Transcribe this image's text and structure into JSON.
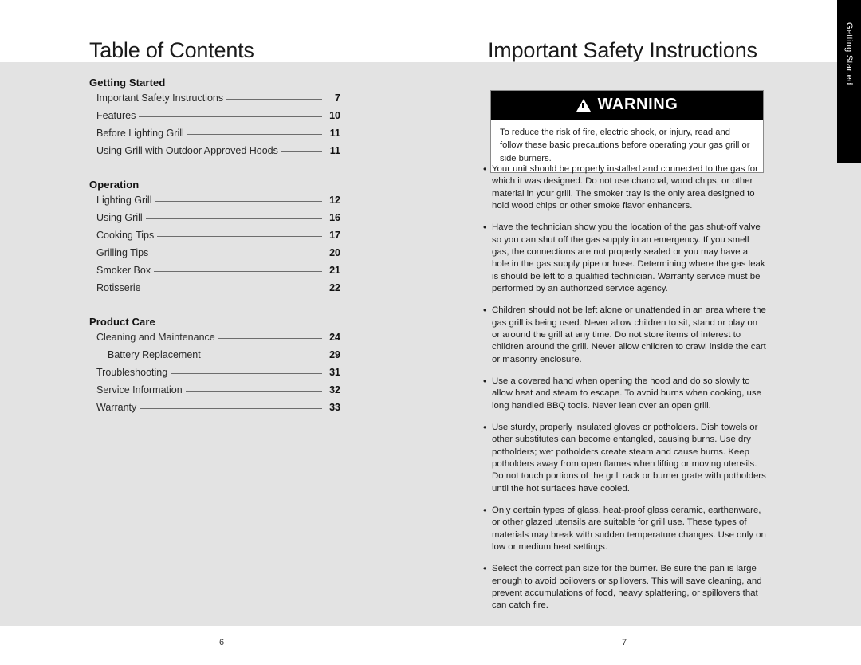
{
  "document": {
    "background_color": "#e3e3e3",
    "page_color": "#ffffff"
  },
  "thumb_tab": {
    "label": "Getting Started",
    "background_color": "#000000",
    "text_color": "#ffffff"
  },
  "left_page": {
    "title": "Table of Contents",
    "page_number": "6",
    "toc": [
      {
        "heading": "Getting Started",
        "entries": [
          {
            "label": "Important Safety Instructions",
            "page": "7",
            "indent": false
          },
          {
            "label": "Features",
            "page": "10",
            "indent": false
          },
          {
            "label": "Before Lighting Grill",
            "page": "11",
            "indent": false
          },
          {
            "label": "Using Grill with Outdoor Approved Hoods",
            "page": "11",
            "indent": false
          }
        ]
      },
      {
        "heading": "Operation",
        "entries": [
          {
            "label": "Lighting Grill",
            "page": "12",
            "indent": false
          },
          {
            "label": "Using Grill",
            "page": "16",
            "indent": false
          },
          {
            "label": "Cooking Tips",
            "page": "17",
            "indent": false
          },
          {
            "label": "Grilling Tips",
            "page": "20",
            "indent": false
          },
          {
            "label": "Smoker Box",
            "page": "21",
            "indent": false
          },
          {
            "label": "Rotisserie",
            "page": "22",
            "indent": false
          }
        ]
      },
      {
        "heading": "Product Care",
        "entries": [
          {
            "label": "Cleaning and Maintenance",
            "page": "24",
            "indent": false
          },
          {
            "label": "Battery Replacement",
            "page": "29",
            "indent": true
          },
          {
            "label": "Troubleshooting",
            "page": "31",
            "indent": false
          },
          {
            "label": "Service Information",
            "page": "32",
            "indent": false
          },
          {
            "label": "Warranty",
            "page": "33",
            "indent": false
          }
        ]
      }
    ]
  },
  "right_page": {
    "title": "Important Safety Instructions",
    "page_number": "7",
    "warning": {
      "icon": "warning-triangle-icon",
      "heading": "WARNING",
      "body": "To reduce the risk of fire, electric shock, or injury, read and follow these basic precautions before operating your gas grill or side burners.",
      "header_background": "#000000",
      "header_text_color": "#ffffff",
      "body_background": "#ffffff"
    },
    "bullet_char": "•",
    "safety_items": [
      "Your unit should be properly installed and connected to the gas for which it was designed. Do not use charcoal, wood chips, or other material in your grill. The smoker tray is the only area designed to hold wood chips or other smoke flavor enhancers.",
      "Have the technician show you the location of the gas shut-off valve so you can shut off the gas supply in an emergency. If you smell gas, the connections are not properly sealed or you may have a hole in the gas supply pipe or hose. Determining where the gas leak is should be left to a qualified technician. Warranty service must be performed by an authorized service agency.",
      "Children should not be left alone or unattended in an area where the gas grill is being used. Never allow children to sit, stand or play on or around the grill at any time. Do not store items of interest to children around the grill. Never allow children to crawl inside the cart or masonry enclosure.",
      "Use a covered hand when opening the hood and do so slowly to allow heat and steam to escape. To avoid burns when cooking, use long handled BBQ tools. Never lean over an open grill.",
      "Use sturdy, properly insulated gloves or potholders. Dish towels or other substitutes can become entangled, causing burns. Use dry potholders; wet potholders create steam and cause burns. Keep potholders away from open flames when lifting or moving utensils. Do not touch portions of the grill rack or burner grate with potholders until the hot surfaces have cooled.",
      "Only certain types of glass, heat-proof glass ceramic, earthenware, or other glazed utensils are suitable for grill use. These types of materials may break with sudden temperature changes. Use only on low or medium heat settings.",
      "Select the correct pan size for the burner. Be sure the pan is large enough to avoid boilovers or spillovers. This will save cleaning, and prevent accumulations of food, heavy splattering, or spillovers that can catch fire."
    ]
  }
}
